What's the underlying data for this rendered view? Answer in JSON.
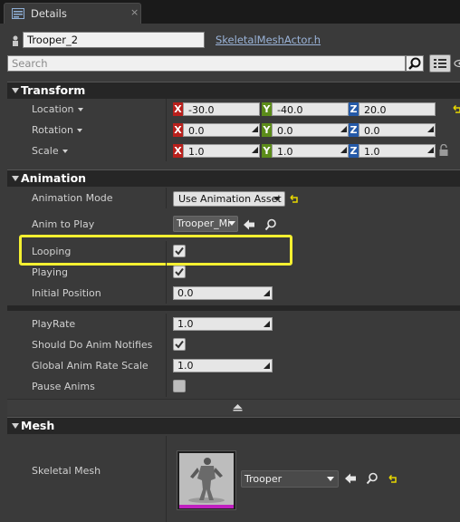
{
  "tab": {
    "label": "Details",
    "close": "×"
  },
  "actor": {
    "name": "Trooper_2",
    "class_link": "SkeletalMeshActor.h"
  },
  "search": {
    "placeholder": "Search"
  },
  "transform": {
    "header": "Transform",
    "rows": [
      {
        "label": "Location",
        "x": "-30.0",
        "y": "-40.0",
        "z": "20.0"
      },
      {
        "label": "Rotation",
        "x": "0.0",
        "y": "0.0",
        "z": "0.0"
      },
      {
        "label": "Scale",
        "x": "1.0",
        "y": "1.0",
        "z": "1.0"
      }
    ],
    "axis_labels": {
      "x": "X",
      "y": "Y",
      "z": "Z"
    }
  },
  "animation": {
    "header": "Animation",
    "mode_label": "Animation Mode",
    "mode_value": "Use Animation Asset",
    "anim_to_play_label": "Anim to Play",
    "anim_to_play_value": "Trooper_Mi",
    "looping_label": "Looping",
    "looping": true,
    "playing_label": "Playing",
    "playing": true,
    "initial_position_label": "Initial Position",
    "initial_position": "0.0",
    "play_rate_label": "PlayRate",
    "play_rate": "1.0",
    "notifies_label": "Should Do Anim Notifies",
    "notifies": true,
    "global_rate_label": "Global Anim Rate Scale",
    "global_rate": "1.0",
    "pause_label": "Pause Anims",
    "pause": false
  },
  "mesh": {
    "header": "Mesh",
    "skeletal_mesh_label": "Skeletal Mesh",
    "skeletal_mesh_value": "Trooper"
  },
  "colors": {
    "highlight": "#f4f031",
    "axis_x": "#b8201c",
    "axis_y": "#5c8c1a",
    "axis_z": "#255aa8",
    "reset_arrow": "#e8d800",
    "thumbnail_bar": "#c020c0"
  }
}
